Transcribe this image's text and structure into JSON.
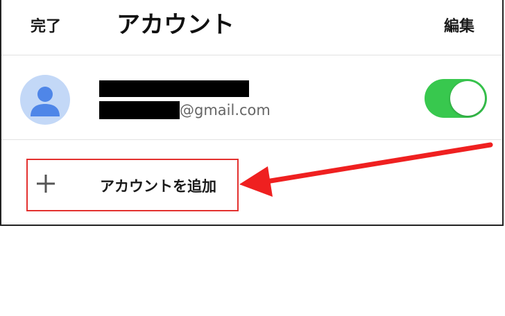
{
  "navbar": {
    "done_label": "完了",
    "title": "アカウント",
    "edit_label": "編集"
  },
  "account": {
    "email_domain": "@gmail.com",
    "enabled": true
  },
  "add_account": {
    "label": "アカウントを追加",
    "icon": "plus-icon"
  },
  "colors": {
    "toggle_on": "#38c84e",
    "avatar_bg": "#c3d8f7",
    "avatar_figure": "#4f86e8",
    "highlight": "#e3312f"
  }
}
